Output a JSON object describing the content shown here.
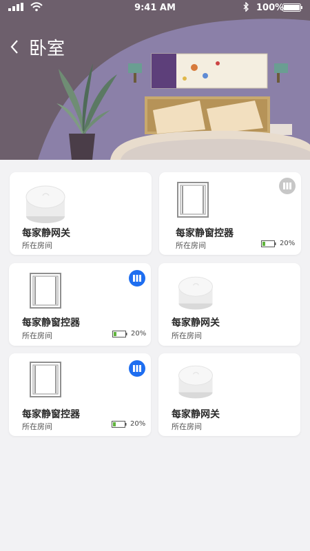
{
  "status_bar": {
    "time": "9:41 AM",
    "battery": "100%"
  },
  "header": {
    "title": "卧室"
  },
  "devices": [
    {
      "name": "每家静网关",
      "room": "所在房间",
      "type": "gateway"
    },
    {
      "name": "每家静窗控器",
      "room": "所在房间",
      "type": "window-controller",
      "battery": "20%",
      "badge": "gray"
    },
    {
      "name": "每家静窗控器",
      "room": "所在房间",
      "type": "window-controller",
      "battery": "20%",
      "badge": "blue"
    },
    {
      "name": "每家静网关",
      "room": "所在房间",
      "type": "gateway"
    },
    {
      "name": "每家静窗控器",
      "room": "所在房间",
      "type": "window-controller",
      "battery": "20%",
      "badge": "blue"
    },
    {
      "name": "每家静网关",
      "room": "所在房间",
      "type": "gateway"
    }
  ],
  "colors": {
    "hero_background": "#6d5f6c",
    "hero_arch": "#8b80a8",
    "accent_blue": "#1e6ef0",
    "badge_gray": "#c7c7c7",
    "battery_green": "#5fb33c"
  }
}
